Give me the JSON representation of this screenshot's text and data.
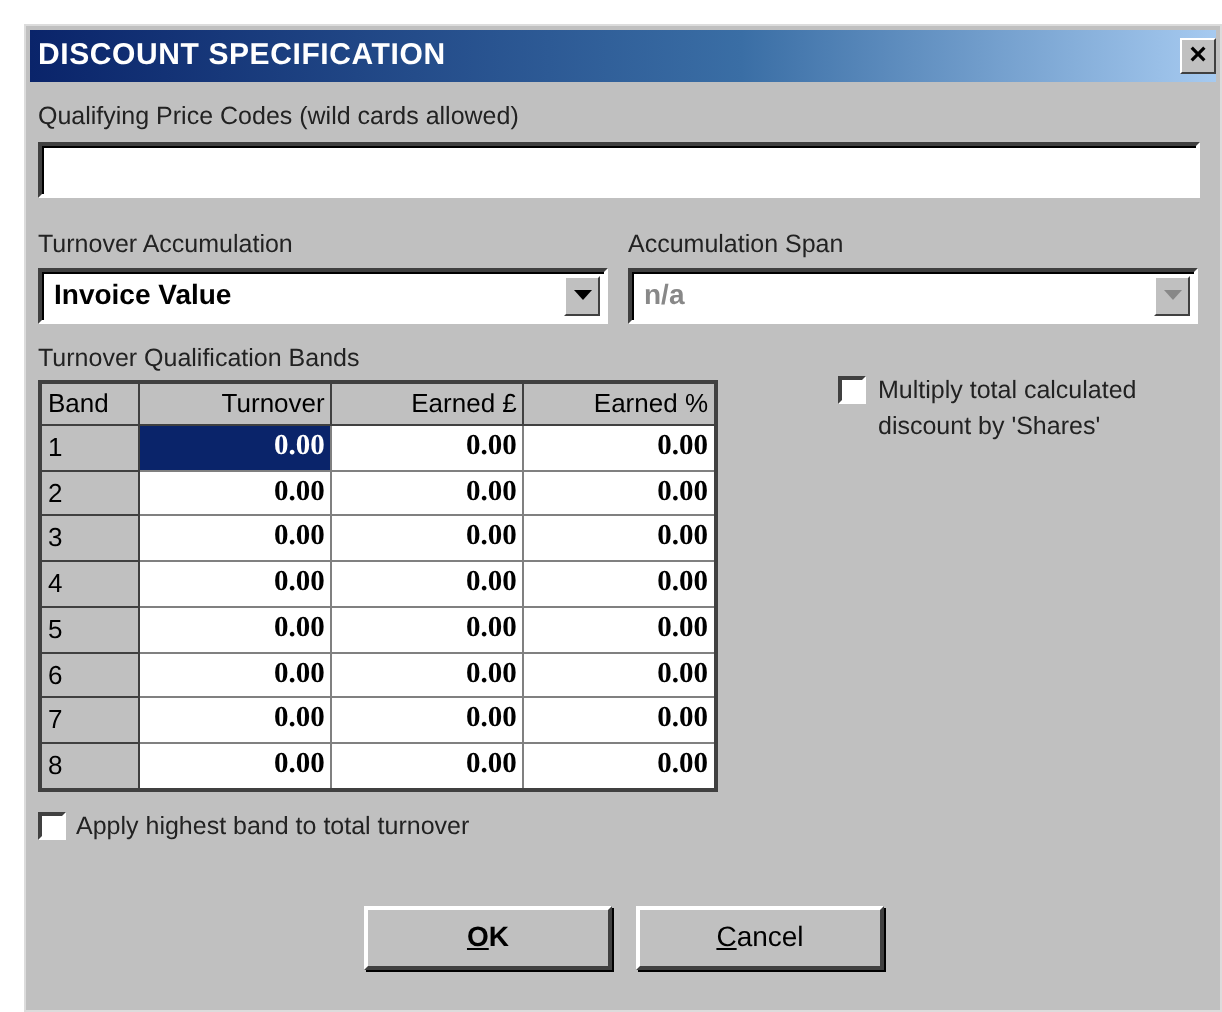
{
  "window": {
    "title": "DISCOUNT SPECIFICATION",
    "close": "×"
  },
  "price_codes": {
    "label": "Qualifying Price Codes (wild cards allowed)"
  },
  "turnover_accumulation": {
    "label": "Turnover Accumulation",
    "value": "Invoice Value",
    "disabled": false
  },
  "accumulation_span": {
    "label": "Accumulation Span",
    "value": "n/a",
    "disabled": true
  },
  "bands": {
    "label": "Turnover Qualification Bands",
    "columns": [
      "Band",
      "Turnover",
      "Earned £",
      "Earned %"
    ],
    "rows": [
      {
        "cells": [
          {
            "kind": "header",
            "text": "1"
          },
          {
            "kind": "value",
            "text": "0.00",
            "selected": true
          },
          {
            "kind": "value",
            "text": "0.00",
            "selected": false
          },
          {
            "kind": "value",
            "text": "0.00",
            "selected": false
          }
        ]
      },
      {
        "cells": [
          {
            "kind": "header",
            "text": "2"
          },
          {
            "kind": "value",
            "text": "0.00",
            "selected": false
          },
          {
            "kind": "value",
            "text": "0.00",
            "selected": false
          },
          {
            "kind": "value",
            "text": "0.00",
            "selected": false
          }
        ]
      },
      {
        "cells": [
          {
            "kind": "header",
            "text": "3"
          },
          {
            "kind": "value",
            "text": "0.00",
            "selected": false
          },
          {
            "kind": "value",
            "text": "0.00",
            "selected": false
          },
          {
            "kind": "value",
            "text": "0.00",
            "selected": false
          }
        ]
      },
      {
        "cells": [
          {
            "kind": "header",
            "text": "4"
          },
          {
            "kind": "value",
            "text": "0.00",
            "selected": false
          },
          {
            "kind": "value",
            "text": "0.00",
            "selected": false
          },
          {
            "kind": "value",
            "text": "0.00",
            "selected": false
          }
        ]
      },
      {
        "cells": [
          {
            "kind": "header",
            "text": "5"
          },
          {
            "kind": "value",
            "text": "0.00",
            "selected": false
          },
          {
            "kind": "value",
            "text": "0.00",
            "selected": false
          },
          {
            "kind": "value",
            "text": "0.00",
            "selected": false
          }
        ]
      },
      {
        "cells": [
          {
            "kind": "header",
            "text": "6"
          },
          {
            "kind": "value",
            "text": "0.00",
            "selected": false
          },
          {
            "kind": "value",
            "text": "0.00",
            "selected": false
          },
          {
            "kind": "value",
            "text": "0.00",
            "selected": false
          }
        ]
      },
      {
        "cells": [
          {
            "kind": "header",
            "text": "7"
          },
          {
            "kind": "value",
            "text": "0.00",
            "selected": false
          },
          {
            "kind": "value",
            "text": "0.00",
            "selected": false
          },
          {
            "kind": "value",
            "text": "0.00",
            "selected": false
          }
        ]
      },
      {
        "cells": [
          {
            "kind": "header",
            "text": "8"
          },
          {
            "kind": "value",
            "text": "0.00",
            "selected": false
          },
          {
            "kind": "value",
            "text": "0.00",
            "selected": false
          },
          {
            "kind": "value",
            "text": "0.00",
            "selected": false
          }
        ]
      }
    ]
  },
  "multiply_shares": {
    "label": "Multiply total calculated discount by 'Shares'",
    "checked": false
  },
  "apply_highest": {
    "label": "Apply highest band to total turnover",
    "checked": false
  },
  "buttons": [
    {
      "label": "OK",
      "underline_first": true,
      "default": true
    },
    {
      "label": "Cancel",
      "underline_first": true,
      "default": false
    }
  ]
}
